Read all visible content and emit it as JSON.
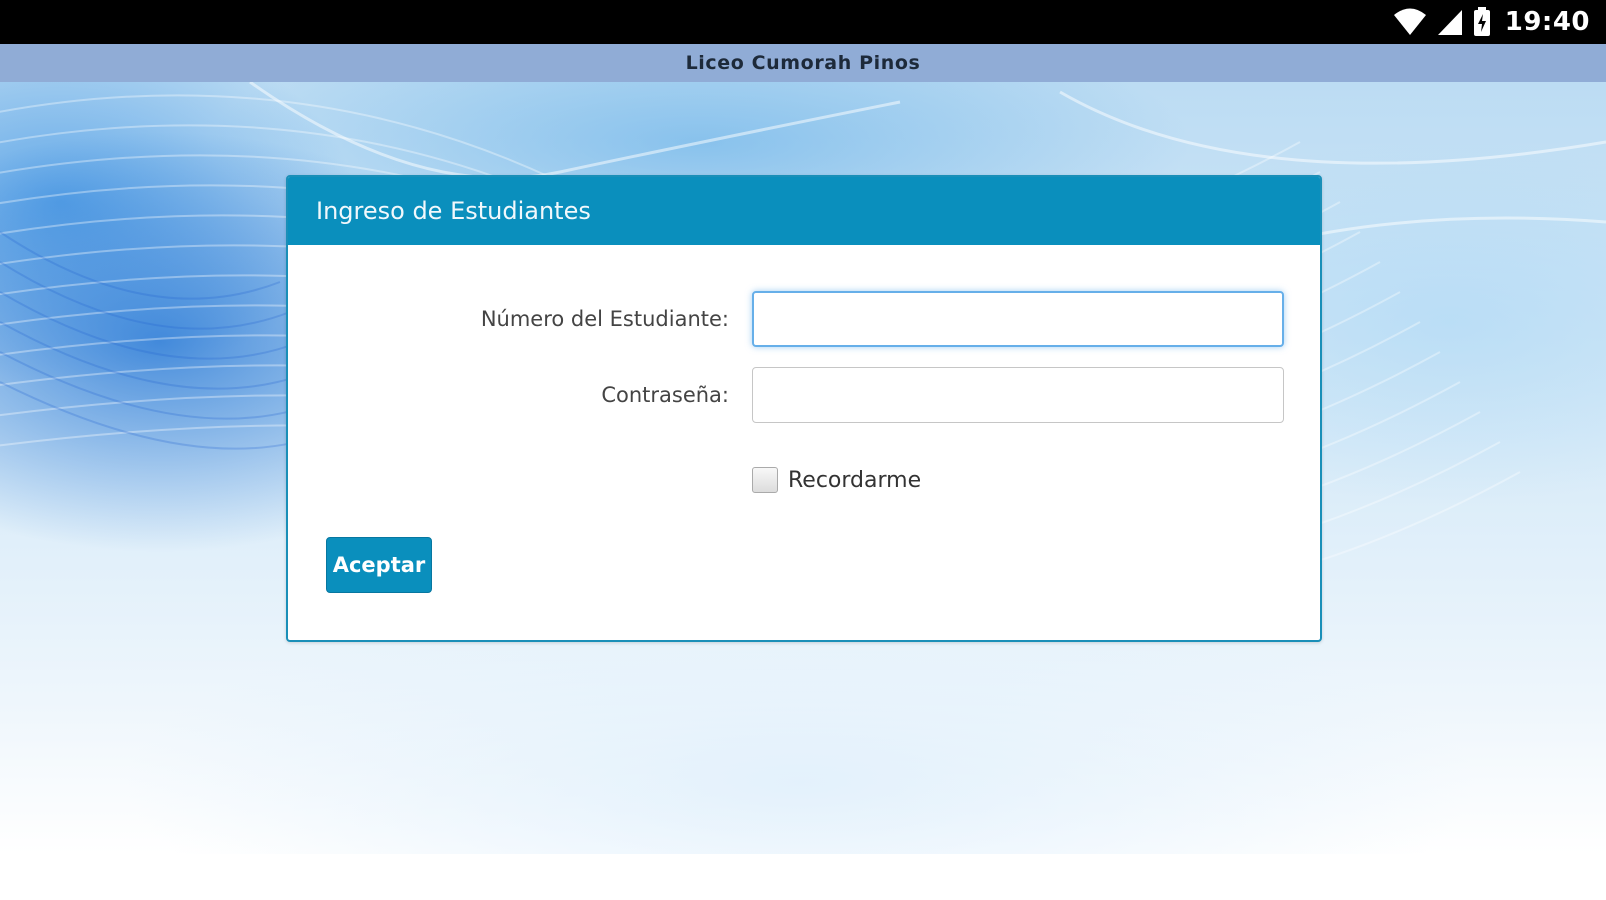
{
  "status_bar": {
    "time": "19:40",
    "icons": [
      "wifi-icon",
      "signal-icon",
      "battery-icon"
    ]
  },
  "title_bar": {
    "title": "Liceo Cumorah Pinos"
  },
  "login_panel": {
    "title": "Ingreso de Estudiantes",
    "student_number_label": "Número del Estudiante:",
    "student_number_value": "",
    "password_label": "Contraseña:",
    "password_value": "",
    "remember_label": "Recordarme",
    "remember_checked": false,
    "submit_label": "Aceptar"
  },
  "colors": {
    "status_bar": "#000000",
    "title_bar": "#90acd6",
    "panel_header": "#0a8fbd",
    "button": "#0a8fbd",
    "focus_ring": "#66afe9"
  }
}
